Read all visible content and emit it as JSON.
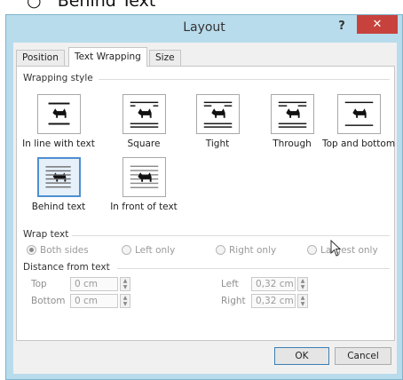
{
  "background": {
    "text": "○   Behind Text"
  },
  "dialog": {
    "title": "Layout",
    "help_label": "?",
    "close_label": "✕",
    "tabs": [
      {
        "label": "Position"
      },
      {
        "label": "Text Wrapping"
      },
      {
        "label": "Size"
      }
    ],
    "wrapping_style": {
      "heading": "Wrapping style",
      "options": [
        {
          "label": "In line with text",
          "icon": "wrap-inline-icon"
        },
        {
          "label": "Square",
          "icon": "wrap-square-icon"
        },
        {
          "label": "Tight",
          "icon": "wrap-tight-icon"
        },
        {
          "label": "Through",
          "icon": "wrap-through-icon"
        },
        {
          "label": "Top and bottom",
          "icon": "wrap-top-bottom-icon"
        },
        {
          "label": "Behind text",
          "icon": "wrap-behind-text-icon",
          "selected": true
        },
        {
          "label": "In front of text",
          "icon": "wrap-in-front-icon"
        }
      ]
    },
    "wrap_text": {
      "heading": "Wrap text",
      "options": [
        {
          "label": "Both sides",
          "checked": true
        },
        {
          "label": "Left only"
        },
        {
          "label": "Right only"
        },
        {
          "label": "Largest only"
        }
      ]
    },
    "distance": {
      "heading": "Distance from text",
      "top": {
        "label": "Top",
        "value": "0 cm"
      },
      "bottom": {
        "label": "Bottom",
        "value": "0 cm"
      },
      "left": {
        "label": "Left",
        "value": "0,32 cm"
      },
      "right": {
        "label": "Right",
        "value": "0,32 cm"
      }
    },
    "ok_label": "OK",
    "cancel_label": "Cancel"
  }
}
